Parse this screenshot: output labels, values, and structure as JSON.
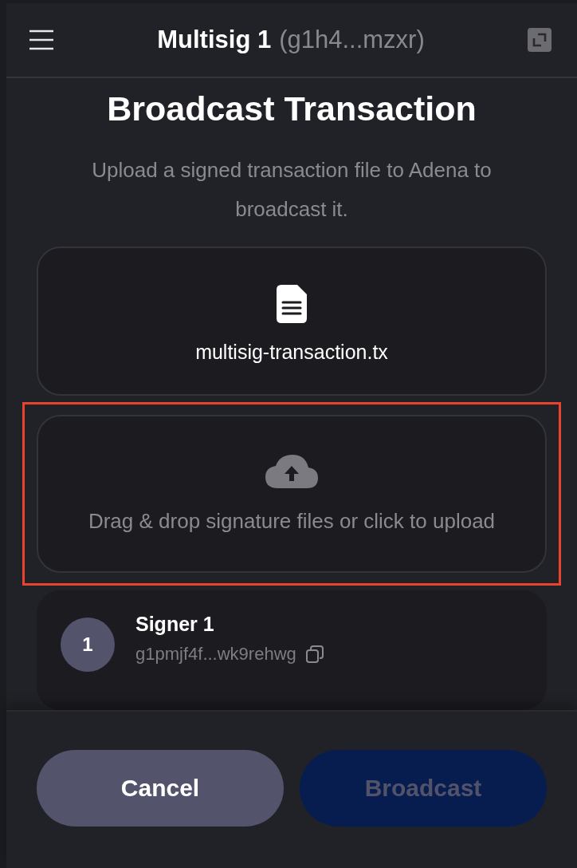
{
  "header": {
    "wallet_name": "Multisig 1",
    "wallet_address": "(g1h4...mzxr)"
  },
  "title": "Broadcast Transaction",
  "subtitle": "Upload a signed transaction file to Adena to broadcast it.",
  "transaction_file": {
    "name": "multisig-transaction.tx"
  },
  "signature_upload": {
    "label": "Drag & drop signature files or click to upload",
    "highlighted": true
  },
  "signers": [
    {
      "number": "1",
      "name": "Signer 1",
      "address": "g1pmjf4f...wk9rehwg"
    }
  ],
  "buttons": [
    {
      "label": "Cancel",
      "kind": "secondary",
      "disabled": false
    },
    {
      "label": "Broadcast",
      "kind": "primary",
      "disabled": true
    }
  ]
}
